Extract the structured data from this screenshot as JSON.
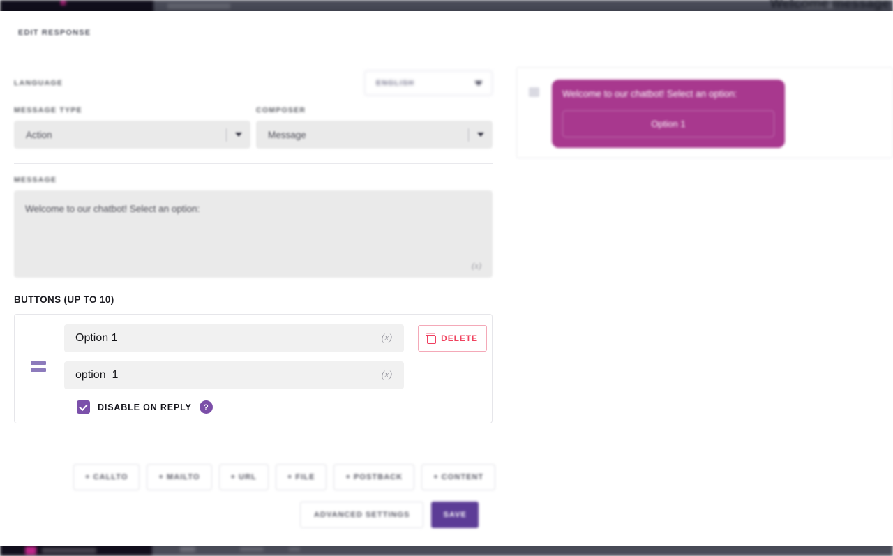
{
  "background": {
    "app_title": "Welcome message"
  },
  "modal": {
    "header_title": "EDIT RESPONSE",
    "language": {
      "label": "LANGUAGE",
      "selected": "ENGLISH"
    },
    "message_type": {
      "label": "MESSAGE TYPE",
      "selected": "Action"
    },
    "composer": {
      "label": "COMPOSER",
      "selected": "Message"
    },
    "message": {
      "label": "MESSAGE",
      "value": "Welcome to our chatbot! Select an option:",
      "variable_icon": "(x)"
    },
    "buttons_section": {
      "heading": "BUTTONS (UP TO 10)",
      "rows": [
        {
          "title_value": "Option 1",
          "title_variable_icon": "(x)",
          "payload_value": "option_1",
          "payload_variable_icon": "(x)",
          "delete_label": "DELETE",
          "disable_on_reply_label": "DISABLE ON REPLY",
          "disable_on_reply_checked": true,
          "help_glyph": "?"
        }
      ]
    },
    "add_buttons": [
      {
        "label": "+ CALLTO"
      },
      {
        "label": "+ MAILTO"
      },
      {
        "label": "+ URL"
      },
      {
        "label": "+ FILE"
      },
      {
        "label": "+ POSTBACK"
      },
      {
        "label": "+ CONTENT"
      }
    ],
    "footer": {
      "advanced_settings_label": "ADVANCED SETTINGS",
      "save_label": "SAVE"
    }
  },
  "preview": {
    "bubble_text": "Welcome to our chatbot! Select an option:",
    "bubble_button_label": "Option 1"
  },
  "colors": {
    "brand_purple": "#5c3c96",
    "checkbox_purple": "#7b50aa",
    "bubble_magenta": "#a8388e",
    "delete_red": "#f0435f"
  }
}
